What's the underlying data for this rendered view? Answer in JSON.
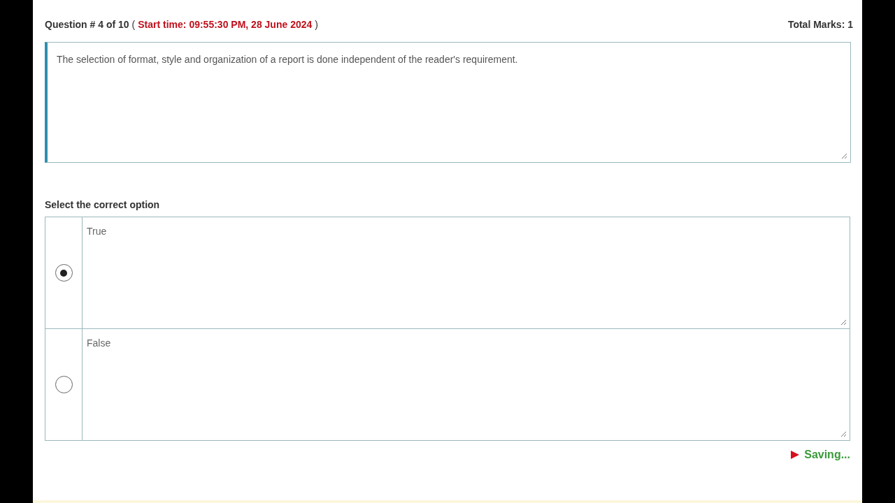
{
  "header": {
    "question_label": "Question # 4 of 10",
    "open_paren": "(",
    "start_time": "Start time: 09:55:30 PM, 28 June 2024",
    "close_paren": ")",
    "total_marks": "Total Marks: 1"
  },
  "question": {
    "text": "The selection of format, style and organization of a report is done independent of the reader's requirement."
  },
  "prompt": "Select the correct option",
  "options": [
    {
      "text": "True",
      "selected": true
    },
    {
      "text": "False",
      "selected": false
    }
  ],
  "status": "Saving..."
}
